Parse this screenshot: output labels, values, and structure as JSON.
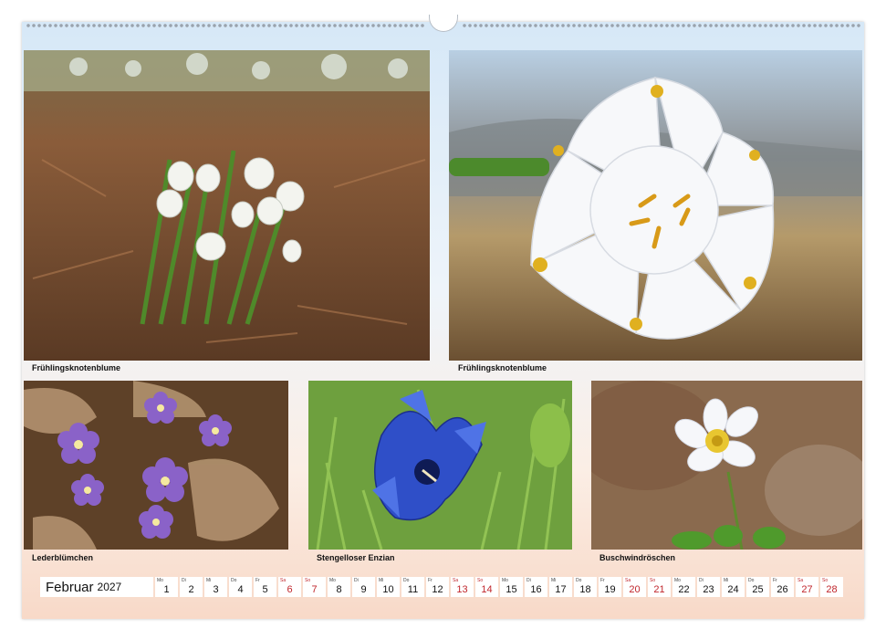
{
  "captions": {
    "photo1": "Frühlingsknotenblume",
    "photo2": "Frühlingsknotenblume",
    "photo3": "Lederblümchen",
    "photo4": "Stengelloser Enzian",
    "photo5": "Buschwindröschen"
  },
  "calendar": {
    "month": "Februar",
    "year": "2027",
    "days": [
      {
        "wd": "Mo",
        "n": "1"
      },
      {
        "wd": "Di",
        "n": "2"
      },
      {
        "wd": "Mi",
        "n": "3"
      },
      {
        "wd": "Do",
        "n": "4"
      },
      {
        "wd": "Fr",
        "n": "5"
      },
      {
        "wd": "Sa",
        "n": "6"
      },
      {
        "wd": "So",
        "n": "7"
      },
      {
        "wd": "Mo",
        "n": "8"
      },
      {
        "wd": "Di",
        "n": "9"
      },
      {
        "wd": "Mi",
        "n": "10"
      },
      {
        "wd": "Do",
        "n": "11"
      },
      {
        "wd": "Fr",
        "n": "12"
      },
      {
        "wd": "Sa",
        "n": "13"
      },
      {
        "wd": "So",
        "n": "14"
      },
      {
        "wd": "Mo",
        "n": "15"
      },
      {
        "wd": "Di",
        "n": "16"
      },
      {
        "wd": "Mi",
        "n": "17"
      },
      {
        "wd": "Do",
        "n": "18"
      },
      {
        "wd": "Fr",
        "n": "19"
      },
      {
        "wd": "Sa",
        "n": "20"
      },
      {
        "wd": "So",
        "n": "21"
      },
      {
        "wd": "Mo",
        "n": "22"
      },
      {
        "wd": "Di",
        "n": "23"
      },
      {
        "wd": "Mi",
        "n": "24"
      },
      {
        "wd": "Do",
        "n": "25"
      },
      {
        "wd": "Fr",
        "n": "26"
      },
      {
        "wd": "Sa",
        "n": "27"
      },
      {
        "wd": "So",
        "n": "28"
      }
    ],
    "weekend_labels": [
      "Sa",
      "So"
    ],
    "weekend_color": "#c0262c"
  }
}
